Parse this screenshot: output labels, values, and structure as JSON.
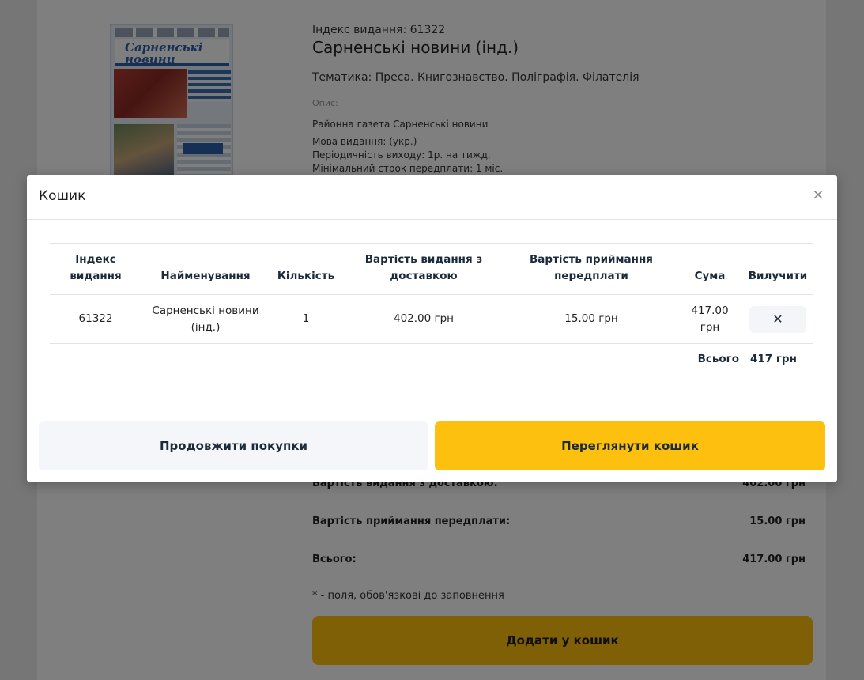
{
  "product": {
    "index_line": "Індекс видання: 61322",
    "title": "Сарненські новини (інд.)",
    "theme": "Тематика: Преса. Книгознавство. Поліграфія. Філателія",
    "desc_label": "Опис:",
    "desc_lines": [
      "Районна газета Сарненські новини",
      "Мова видання: (укр.)",
      "Періодичність виходу: 1р. на тижд.",
      "Мінімальний строк передплати: 1 міс."
    ],
    "cover_masthead": "Сарненські новини"
  },
  "pricing": {
    "rows": [
      {
        "label": "Вартість видання з доставкою:",
        "value": "402.00 грн"
      },
      {
        "label": "Вартість приймання передплати:",
        "value": "15.00 грн"
      },
      {
        "label": "Всього:",
        "value": "417.00 грн"
      }
    ],
    "required_note": "* - поля, обов'язкові до заповнення",
    "add_to_cart_label": "Додати у кошик"
  },
  "modal": {
    "title": "Кошик",
    "close_symbol": "×",
    "columns": [
      "Індекс видання",
      "Найменування",
      "Кількість",
      "Вартість видання з доставкою",
      "Вартість приймання передплати",
      "Сума",
      "Вилучити"
    ],
    "items": [
      {
        "index": "61322",
        "name": "Сарненські новини (інд.)",
        "qty": "1",
        "cost": "402.00 грн",
        "fee": "15.00 грн",
        "sum": "417.00 грн",
        "remove_symbol": "✕"
      }
    ],
    "total_label": "Всього",
    "total_value": "417 грн",
    "continue_label": "Продовжити покупки",
    "view_cart_label": "Переглянути кошик"
  },
  "colors": {
    "accent": "#fec00f",
    "overlay": "rgba(0,0,0,0.5)",
    "secondary_button": "#f4f6f9",
    "heading_text": "#1c2b3a"
  }
}
